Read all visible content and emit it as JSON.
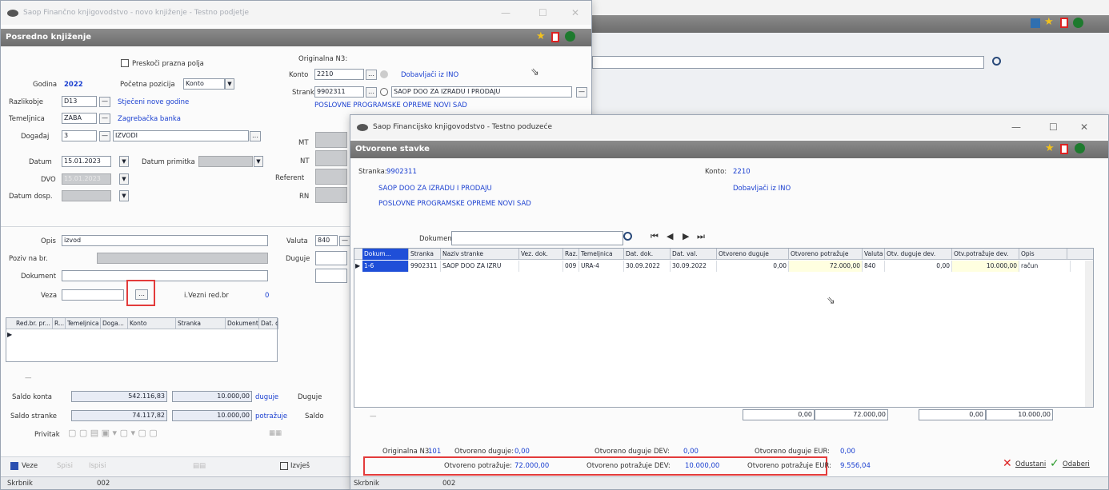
{
  "background": {
    "search_icon": "search-icon"
  },
  "main_window": {
    "title": "Saop Finančno knjigovodstvo - novo knjiženje - Testno podjetje",
    "header": "Posredno knjiženje",
    "skip_mandatory_label": "Preskoči prazna polja",
    "year_label": "Godina",
    "year_value": "2022",
    "start_position_label": "Početna pozicija",
    "start_position_value": "Konto",
    "breakdown_label": "Razlikobje",
    "breakdown_value": "D13",
    "breakdown_desc": "Stječeni nove godine",
    "basis_label": "Temeljnica",
    "basis_value": "ZABA",
    "basis_desc": "Zagrebačka banka",
    "event_label": "Događaj",
    "event_value": "3",
    "event_desc": "IZVODI",
    "date_label": "Datum",
    "date_value": "15.01.2023",
    "receipt_date_label": "Datum primitka",
    "dvo_label": "DVO",
    "dvo_value": "15.01.2023",
    "due_date_label": "Datum dosp.",
    "orig_nd_label": "Originalna N3:",
    "konto_label": "Konto",
    "konto_value": "2210",
    "konto_desc": "Dobavljači iz INO",
    "party_label": "Stranka",
    "party_value": "9902311",
    "party_name": "SAOP DOO ZA IZRADU I PRODAJU",
    "party_name2": "POSLOVNE PROGRAMSKE OPREME NOVI SAD",
    "mt_label": "MT",
    "nt_label": "NT",
    "referent_label": "Referent",
    "rn_label": "RN",
    "desc_label": "Opis",
    "desc_value": "izvod",
    "ref_no_label": "Poziv na br.",
    "document_label": "Dokument",
    "link_label": "Veza",
    "link_row_label": "i.Vezni red.br",
    "link_row_value": "0",
    "currency_label": "Valuta",
    "currency_value": "840",
    "debit_label": "Duguje",
    "grid_columns": [
      "Red.br. pr...",
      "R...",
      "Temeljnica",
      "Doga...",
      "Konto",
      "Stranka",
      "Dokument",
      "Dat. dok."
    ],
    "saldo_konta_label": "Saldo konta",
    "saldo_konta_value": "542.116,83",
    "saldo_konta_value2": "10.000,00",
    "saldo_konta_side": "duguje",
    "saldo_stranke_label": "Saldo stranke",
    "saldo_stranke_value": "74.117,82",
    "saldo_stranke_value2": "10.000,00",
    "saldo_stranke_side": "potražuje",
    "attach_label": "Privitak",
    "duguje_label2": "Duguje",
    "saldo_label2": "Saldo",
    "btn_veze": "Veze",
    "btn_spisi": "Spisi",
    "btn_ispisi": "Ispisi",
    "btn_izvjes": "Izvješ",
    "status_user_label": "Skrbnik",
    "status_user_value": "002"
  },
  "dialog": {
    "title": "Saop Financijsko knjigovodstvo - Testno poduzeće",
    "header": "Otvorene stavke",
    "party_label": "Stranka:",
    "party_value": "9902311",
    "party_name": "SAOP DOO ZA IZRADU I PRODAJU",
    "party_name2": "POSLOVNE PROGRAMSKE OPREME NOVI SAD",
    "konto_label": "Konto:",
    "konto_value": "2210",
    "konto_desc": "Dobavljači iz INO",
    "document_label": "Dokument",
    "columns": [
      "Dokum...",
      "Stranka",
      "Naziv stranke",
      "Vez. dok.",
      "Raz.",
      "Temeljnica",
      "Dat. dok.",
      "Dat. val.",
      "Otvoreno duguje",
      "Otvoreno potražuje",
      "Valuta",
      "Otv. duguje dev.",
      "Otv.potražuje dev.",
      "Opis"
    ],
    "rows": [
      [
        "1-6",
        "9902311",
        "SAOP DOO ZA IZRU",
        "",
        "009",
        "URA-4",
        "30.09.2022",
        "30.09.2022",
        "0,00",
        "72.000,00",
        "840",
        "0,00",
        "10.000,00",
        "račun"
      ]
    ],
    "totals": [
      "0,00",
      "72.000,00",
      "0,00",
      "10.000,00"
    ],
    "orig_nd_label": "Originalna N3:",
    "orig_nd_value": "101",
    "open_debit_label": "Otvoreno duguje:",
    "open_debit_value": "0,00",
    "open_debit_dev_label": "Otvoreno duguje DEV:",
    "open_debit_dev_value": "0,00",
    "open_debit_eur_label": "Otvoreno duguje EUR:",
    "open_debit_eur_value": "0,00",
    "open_credit_label": "Otvoreno potražuje:",
    "open_credit_value": "72.000,00",
    "open_credit_dev_label": "Otvoreno potražuje DEV:",
    "open_credit_dev_value": "10.000,00",
    "open_credit_eur_label": "Otvoreno potražuje EUR:",
    "open_credit_eur_value": "9.556,04",
    "cancel_label": "Odustani",
    "select_label": "Odaberi",
    "status_user_label": "Skrbnik",
    "status_user_value": "002"
  },
  "colors": {
    "highlight_red": "#e33b3b",
    "link_blue": "#1a3fd0",
    "header_gray": "#777777",
    "selection_blue": "#1f4fd8",
    "yellow_cell": "#ffffe0"
  }
}
